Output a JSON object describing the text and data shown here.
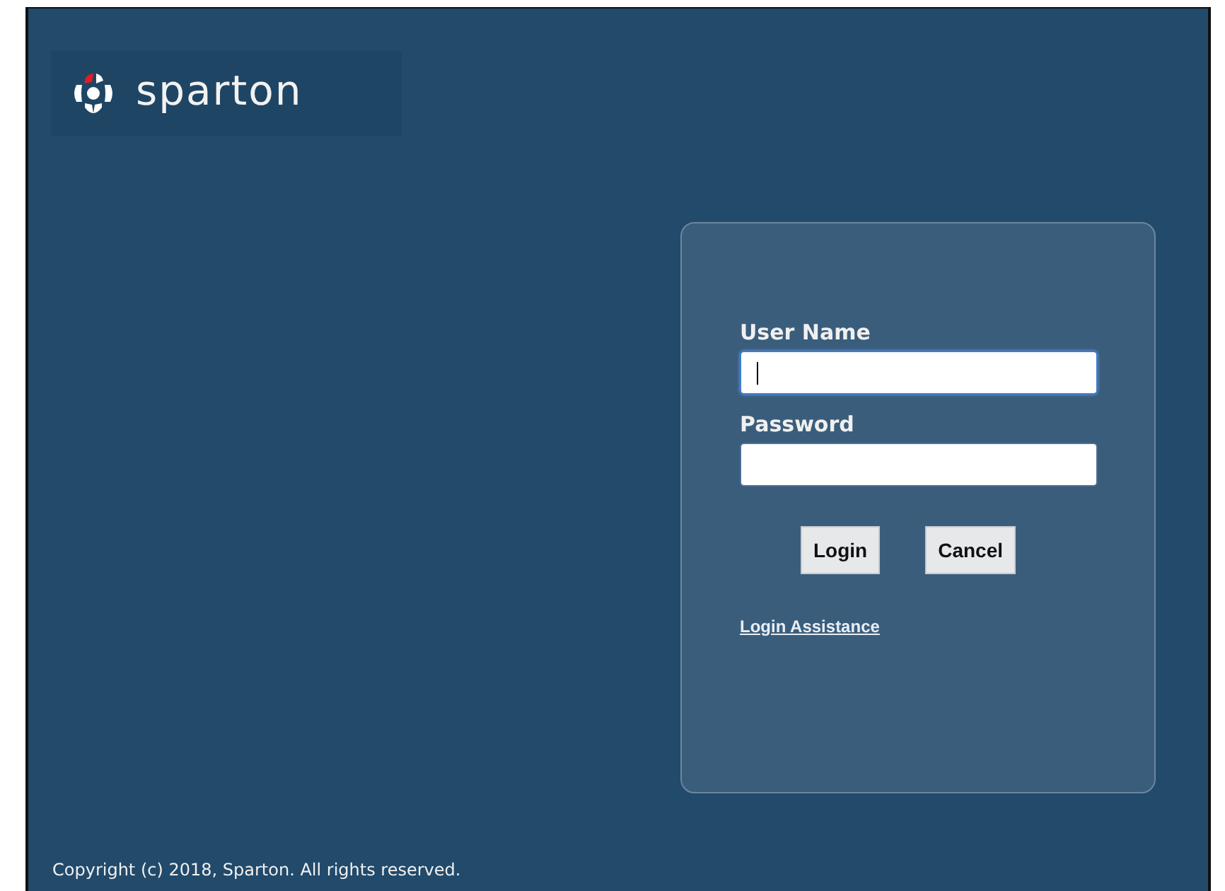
{
  "logo": {
    "text": "sparton"
  },
  "login_form": {
    "fields": [
      {
        "label": "User Name",
        "focused": true
      },
      {
        "label": "Password",
        "focused": false
      }
    ],
    "buttons": [
      "Login",
      "Cancel"
    ],
    "link": "Login Assistance"
  },
  "footer": "Copyright (c) 2018, Sparton. All rights reserved."
}
